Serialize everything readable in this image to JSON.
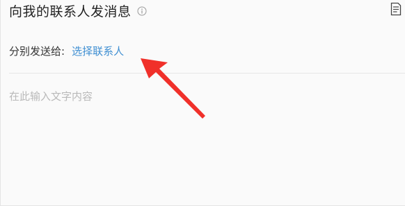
{
  "header": {
    "title": "向我的联系人发消息",
    "info_icon": "info-icon",
    "doc_icon": "document-list-icon"
  },
  "recipients": {
    "label": "分别发送给:",
    "select_link": "选择联系人"
  },
  "message": {
    "placeholder": "在此输入文字内容",
    "value": ""
  },
  "colors": {
    "link": "#3f8fd2",
    "annotation_arrow": "#f0302a"
  }
}
